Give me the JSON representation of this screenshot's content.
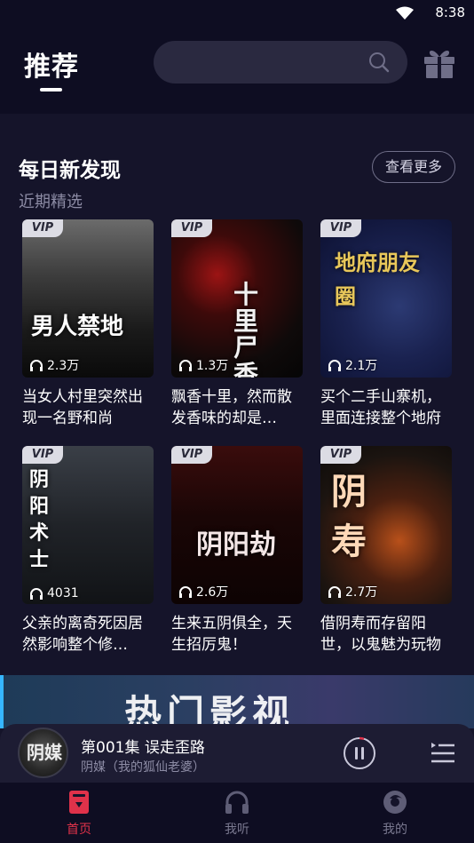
{
  "status_bar": {
    "time": "8:38"
  },
  "header": {
    "tab_label": "推荐",
    "search_placeholder": ""
  },
  "section": {
    "title": "每日新发现",
    "subtitle": "近期精选",
    "more_button": "查看更多"
  },
  "books": [
    {
      "badge": "VIP",
      "plays": "2.3万",
      "cover_text": "男人禁地",
      "description": "当女人村里突然出现一名野和尚",
      "accent": "#3d3d3d"
    },
    {
      "badge": "VIP",
      "plays": "1.3万",
      "cover_text": "十里尸香",
      "description": "飘香十里，然而散发香味的却是…",
      "accent": "#9c1414"
    },
    {
      "badge": "VIP",
      "plays": "2.1万",
      "cover_text": "地府朋友圈",
      "description": "买个二手山寨机，里面连接整个地府",
      "accent": "#2c3a73"
    },
    {
      "badge": "VIP",
      "plays": "4031",
      "cover_text": "阴阳术士",
      "description": "父亲的离奇死因居然影响整个修…",
      "accent": "#3a3f47"
    },
    {
      "badge": "VIP",
      "plays": "2.6万",
      "cover_text": "阴阳劫",
      "description": "生来五阴俱全，天生招厉鬼！",
      "accent": "#3a0c0c"
    },
    {
      "badge": "VIP",
      "plays": "2.7万",
      "cover_text": "阴寿",
      "description": "借阴寿而存留阳世，以鬼魅为玩物",
      "accent": "#b8501a"
    }
  ],
  "banner": {
    "text": "热门影视"
  },
  "player": {
    "art_text": "阴媒",
    "title": "第001集 误走歪路",
    "subtitle": "阴媒（我的狐仙老婆）"
  },
  "nav": {
    "items": [
      {
        "label": "首页",
        "icon": "book-icon",
        "active": true
      },
      {
        "label": "我听",
        "icon": "headphones-icon",
        "active": false
      },
      {
        "label": "我的",
        "icon": "profile-icon",
        "active": false
      }
    ]
  },
  "colors": {
    "accent": "#e0324a",
    "background": "#15142a",
    "header": "#0e0d22"
  }
}
